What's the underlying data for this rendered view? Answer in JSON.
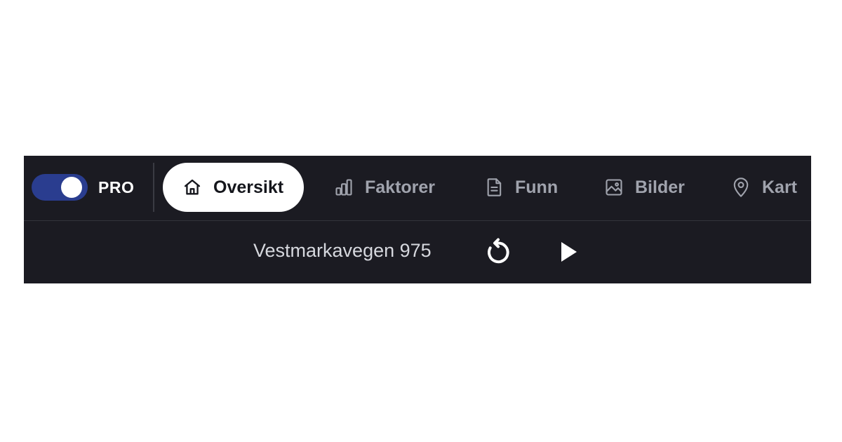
{
  "header": {
    "mode_toggle": {
      "label": "PRO",
      "on": true
    },
    "tabs": [
      {
        "label": "Oversikt",
        "icon": "home-icon",
        "active": true
      },
      {
        "label": "Faktorer",
        "icon": "bar-chart-icon",
        "active": false
      },
      {
        "label": "Funn",
        "icon": "document-icon",
        "active": false
      },
      {
        "label": "Bilder",
        "icon": "image-icon",
        "active": false
      },
      {
        "label": "Kart",
        "icon": "map-pin-icon",
        "active": false
      }
    ]
  },
  "player": {
    "address": "Vestmarkavegen 975",
    "replay_icon": "replay-icon",
    "play_icon": "play-icon"
  },
  "colors": {
    "bar_background": "#1b1b22",
    "toggle_on": "#2a3d8f",
    "tab_inactive_text": "#a0a3ad",
    "tab_active_background": "#ffffff"
  }
}
